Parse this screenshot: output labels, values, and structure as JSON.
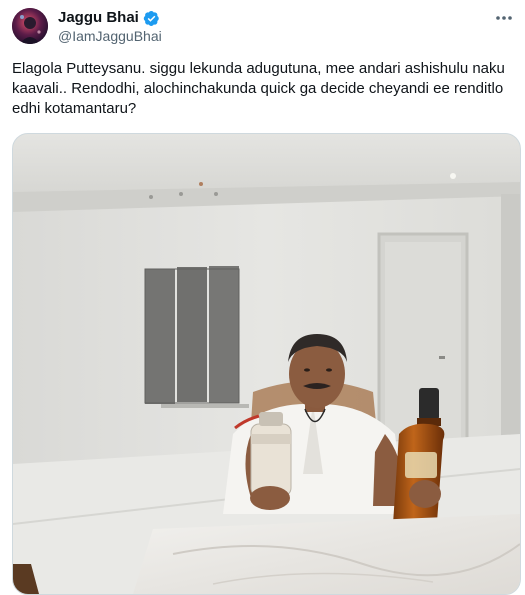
{
  "author": {
    "display_name": "Jaggu Bhai",
    "handle": "@IamJagguBhai",
    "avatar_icon": "profile-avatar",
    "verified_icon": "verified-badge-icon",
    "verified_color": "#1d9bf0"
  },
  "more_icon": "more-options-icon",
  "tweet": {
    "text": "Elagola Putteysanu. siggu lekunda adugutuna, mee andari ashishulu naku kaavali.. Rendodhi, alochinchakunda quick ga decide cheyandi ee renditlo edhi kotamantaru?"
  },
  "media": {
    "type": "photo",
    "scene": "man-seated-at-marble-table-holding-two-bottles"
  }
}
